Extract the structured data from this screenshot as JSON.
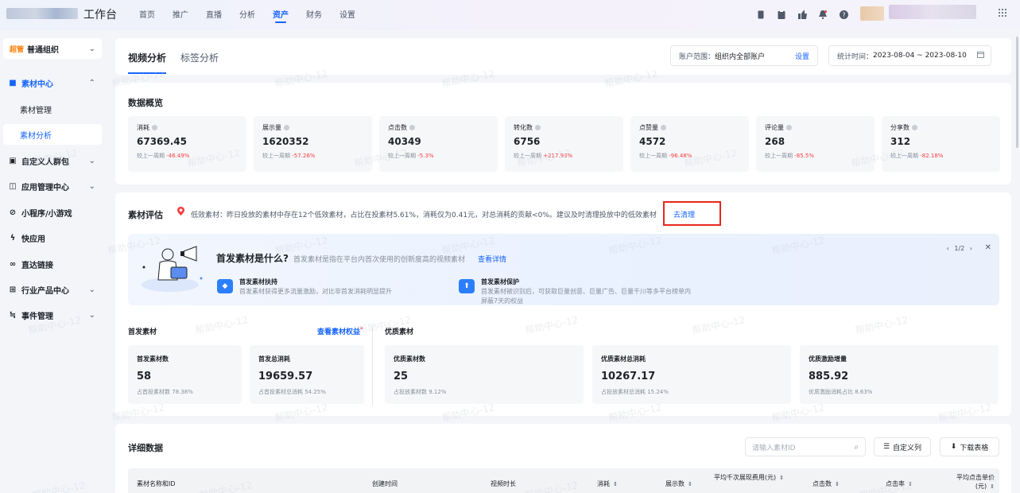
{
  "topbar": {
    "brand": "工作台",
    "nav": [
      "首页",
      "推广",
      "直播",
      "分析",
      "资产",
      "财务",
      "设置"
    ],
    "active_nav": "资产",
    "icons": [
      "mobile-icon",
      "clipboard-icon",
      "thumb-icon",
      "bell-icon",
      "help-icon"
    ]
  },
  "sidebar": {
    "org_tag": "超管",
    "org_name": "普通组织",
    "menu": [
      {
        "label": "素材中心",
        "icon": "▣",
        "expanded": true
      },
      {
        "label": "自定义人群包",
        "icon": "▤"
      },
      {
        "label": "应用管理中心",
        "icon": "▦"
      },
      {
        "label": "小程序/小游戏",
        "icon": "⊘"
      },
      {
        "label": "快应用",
        "icon": "ϟ"
      },
      {
        "label": "直达链接",
        "icon": "⛓"
      },
      {
        "label": "行业产品中心",
        "icon": "⊞"
      },
      {
        "label": "事件管理",
        "icon": "≒"
      }
    ],
    "sub_items": [
      "素材管理",
      "素材分析"
    ]
  },
  "tabs": {
    "items": [
      "视频分析",
      "标签分析"
    ],
    "range_label": "账户范围：",
    "range_value": "组织内全部账户",
    "range_set": "设置",
    "date_label": "统计时间：",
    "date_value": "2023-08-04 ~ 2023-08-10"
  },
  "overview": {
    "title": "数据概览",
    "compare_prefix": "较上一周期",
    "metrics": [
      {
        "label": "消耗",
        "value": "67369.45",
        "change": "-46.49%"
      },
      {
        "label": "展示量",
        "value": "1620352",
        "change": "-57.26%"
      },
      {
        "label": "点击数",
        "value": "40349",
        "change": "-5.3%"
      },
      {
        "label": "转化数",
        "value": "6756",
        "change": "+217.93%"
      },
      {
        "label": "点赞量",
        "value": "4572",
        "change": "-96.48%"
      },
      {
        "label": "评论量",
        "value": "268",
        "change": "-85.5%"
      },
      {
        "label": "分享数",
        "value": "312",
        "change": "-82.18%"
      }
    ]
  },
  "evaluation": {
    "title": "素材评估",
    "warning": "低效素材：昨日投放的素材中存在12个低效素材，占比在投素材5.61%，消耗仅为0.41元，对总消耗的贡献<0%。建议及时清理投放中的低效素材",
    "clean_link": "去清理",
    "banner": {
      "title": "首发素材是什么?",
      "desc": "首发素材是指在平台内首次使用的创新度高的视频素材",
      "detail_link": "查看详情",
      "pager": "1/2",
      "feature1_title": "首发素材扶持",
      "feature1_desc": "首发素材获得更多流量激励，对比非首发消耗明显提升",
      "feature2_title": "首发素材保护",
      "feature2_desc_line1": "首发素材被识别后，可获取巨量创意、巨量广告、巨量千川等多平台榜单内",
      "feature2_desc_line2": "屏蔽7天的权益"
    },
    "first": {
      "title": "首发素材",
      "rights_link": "查看素材权益",
      "cards": [
        {
          "label": "首发素材数",
          "value": "58",
          "sub": "占首投素材数 78.38%"
        },
        {
          "label": "首发总消耗",
          "value": "19659.57",
          "sub": "占首投素材总消耗 54.25%"
        }
      ]
    },
    "quality": {
      "title": "优质素材",
      "cards": [
        {
          "label": "优质素材数",
          "value": "25",
          "sub": "占投放素材数 9.12%"
        },
        {
          "label": "优质素材总消耗",
          "value": "10267.17",
          "sub": "占投放素材总消耗 15.24%"
        },
        {
          "label": "优质激励增量",
          "value": "885.92",
          "sub": "优质激励消耗占比 8.63%"
        }
      ]
    }
  },
  "detail": {
    "title": "详细数据",
    "search_placeholder": "请输入素材ID",
    "custom_cols": "自定义列",
    "download": "下载表格",
    "columns": [
      {
        "label": "素材名称和ID",
        "sortable": false
      },
      {
        "label": "创建时间",
        "sortable": false
      },
      {
        "label": "视频时长",
        "sortable": false
      },
      {
        "label": "消耗",
        "sortable": true
      },
      {
        "label": "展示数",
        "sortable": true
      },
      {
        "label": "平均千次展现费用(元)",
        "sortable": true
      },
      {
        "label": "点击数",
        "sortable": true
      },
      {
        "label": "点击率",
        "sortable": true
      },
      {
        "label": "平均点击单价(元)",
        "sortable": true
      }
    ]
  },
  "watermark_text": "帮助中心-12",
  "colors": {
    "accent": "#1664ff",
    "negative": "#f53f3f",
    "highlight_box": "#e8261b"
  }
}
